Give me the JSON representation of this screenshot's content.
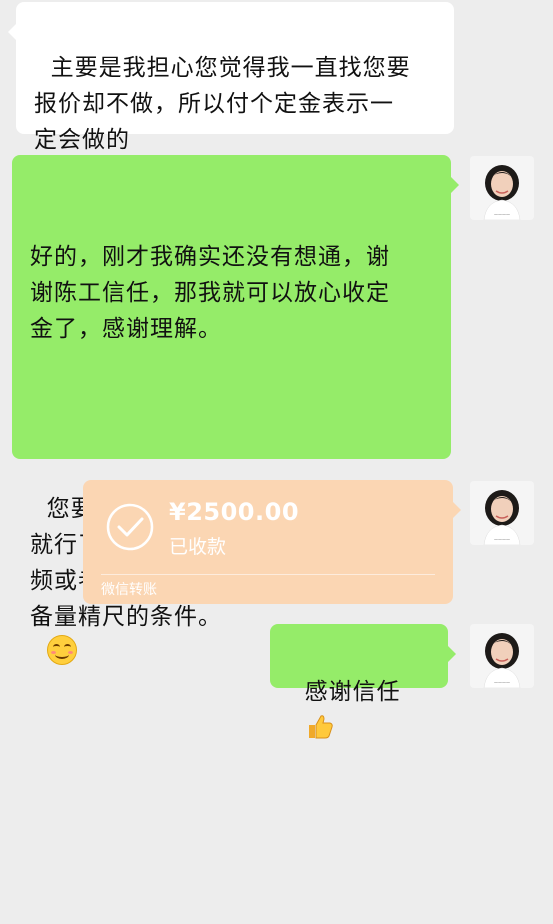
{
  "chat": {
    "incoming_message": "主要是我担心您觉得我一直找您要\n报价却不做，所以付个定金表示一\n定会做的",
    "outgoing_reply": {
      "paragraph1": "好的，刚才我确实还没有想通，谢\n谢陈工信任，那我就可以放心收定\n金了，感谢理解。",
      "paragraph2": "您要量尺的时候，提前一天通知我\n就行了。最好量尺之前把现场的视\n频或者照片发我确认一下，是否具\n备量精尺的条件。",
      "emoji": "smiling-face-emoji"
    },
    "transfer": {
      "amount": "¥2500.00",
      "status": "已收款",
      "footer": "微信转账",
      "color": "#fbd6b3"
    },
    "thanks_message": "感谢信任",
    "thanks_emoji": "thumbs-up-emoji"
  },
  "colors": {
    "background": "#ededed",
    "incoming_bubble": "#ffffff",
    "outgoing_bubble": "#95ec69"
  },
  "avatar": {
    "icon": "avatar-photo"
  }
}
